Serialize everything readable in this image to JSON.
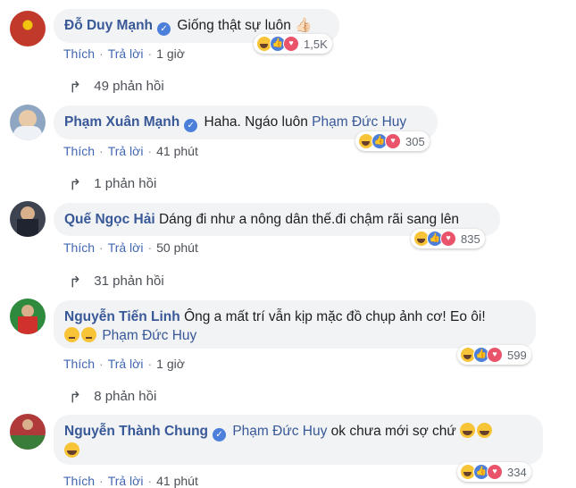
{
  "comments": [
    {
      "name": "Đỗ Duy Mạnh",
      "verified": true,
      "text": "Giống thật sự luôn",
      "trail": "👍🏻",
      "like_label": "Thích",
      "reply_label": "Trả lời",
      "time": "1 giờ",
      "reaction_count": "1,5K",
      "replies": "49 phản hồi",
      "avatar_color": "#c0392b"
    },
    {
      "name": "Phạm Xuân Mạnh",
      "verified": true,
      "text": "Haha. Ngáo luôn",
      "mention": "Phạm Đức Huy",
      "like_label": "Thích",
      "reply_label": "Trả lời",
      "time": "41 phút",
      "reaction_count": "305",
      "replies": "1 phản hồi",
      "avatar_color": "#8fa6c2"
    },
    {
      "name": "Quế Ngọc Hải",
      "verified": false,
      "text": "Dáng đi như a nông dân thế.đi chậm rãi sang lên",
      "like_label": "Thích",
      "reply_label": "Trả lời",
      "time": "50 phút",
      "reaction_count": "835",
      "replies": "31 phản hồi",
      "avatar_color": "#3d4450"
    },
    {
      "name": "Nguyễn Tiến Linh",
      "verified": false,
      "text": "Ông a mất trí vẫn kịp mặc đồ chụp ảnh cơ! Eo ôi!",
      "mention": "Phạm Đức Huy",
      "like_label": "Thích",
      "reply_label": "Trả lời",
      "time": "1 giờ",
      "reaction_count": "599",
      "replies": "8 phản hồi",
      "avatar_color": "#2e8b3d"
    },
    {
      "name": "Nguyễn Thành Chung",
      "verified": true,
      "mention": "Phạm Đức Huy",
      "text": "ok chưa mới sợ chứ",
      "like_label": "Thích",
      "reply_label": "Trả lời",
      "time": "41 phút",
      "reaction_count": "334",
      "avatar_color": "#b03a3a"
    }
  ],
  "colors": {
    "link": "#385898",
    "bubble": "#f2f3f5",
    "action": "#4267b2"
  },
  "icons": [
    "verified-icon",
    "haha-reaction-icon",
    "like-reaction-icon",
    "love-reaction-icon",
    "reply-arrow-icon"
  ]
}
